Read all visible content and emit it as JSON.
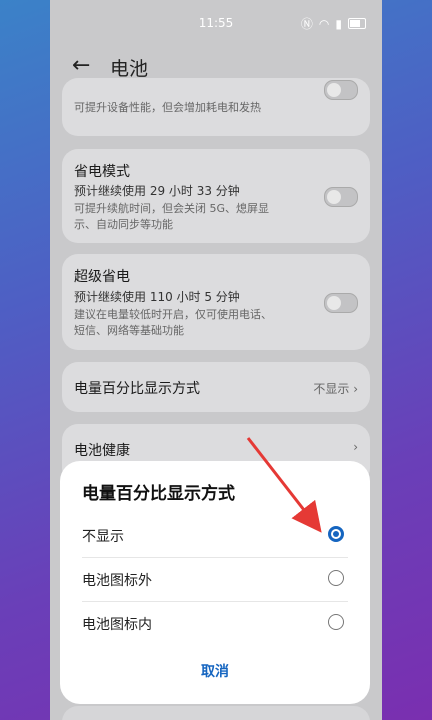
{
  "status_bar": {
    "time": "11:55"
  },
  "header": {
    "title": "电池"
  },
  "cards": {
    "performance_desc": "可提升设备性能，但会增加耗电和发热",
    "power_saving": {
      "title": "省电模式",
      "estimate": "预计继续使用 29 小时 33 分钟",
      "desc_line1": "可提升续航时间，但会关闭 5G、熄屏显",
      "desc_line2": "示、自动同步等功能"
    },
    "super_power_saving": {
      "title": "超级省电",
      "estimate": "预计继续使用 110 小时 5 分钟",
      "desc_line1": "建议在电量较低时开启，仅可使用电话、",
      "desc_line2": "短信、网络等基础功能"
    },
    "percentage_display": {
      "title": "电量百分比显示方式",
      "value": "不显示"
    },
    "battery_health": {
      "title": "电池健康"
    }
  },
  "sheet": {
    "title": "电量百分比显示方式",
    "options": [
      {
        "label": "不显示",
        "selected": true
      },
      {
        "label": "电池图标外",
        "selected": false
      },
      {
        "label": "电池图标内",
        "selected": false
      }
    ],
    "cancel_label": "取消"
  },
  "colors": {
    "accent": "#1565c0",
    "arrow": "#e53935"
  }
}
